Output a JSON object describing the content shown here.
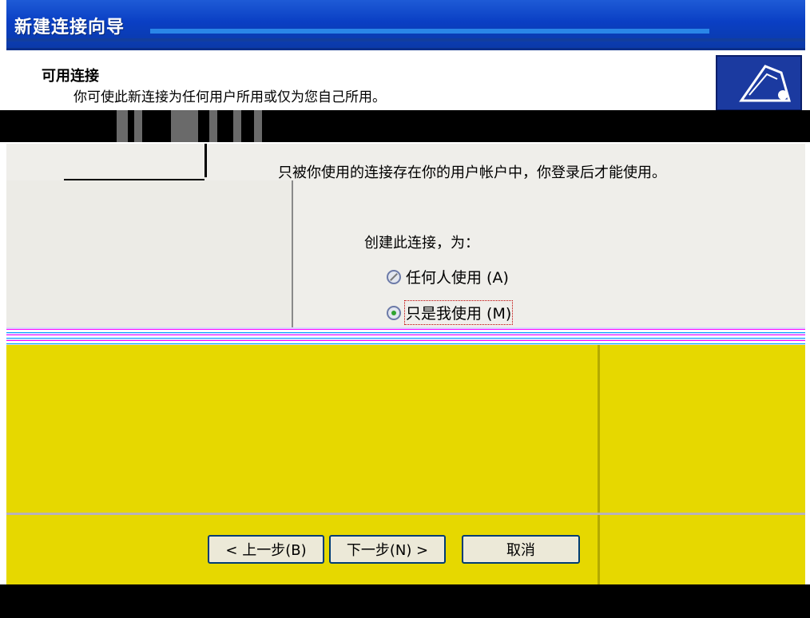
{
  "window": {
    "title": "新建连接向导"
  },
  "header": {
    "heading": "可用连接",
    "subheading": "你可使此新连接为任何用户所用或仅为您自己所用。"
  },
  "body": {
    "notice": "只被你使用的连接存在你的用户帐户中，你登录后才能使用。",
    "section_label": "创建此连接，为：",
    "options": [
      {
        "label": "任何人使用 (A)",
        "selected": false
      },
      {
        "label": "只是我使用 (M)",
        "selected": true
      }
    ]
  },
  "buttons": {
    "back": "< 上一步(B)",
    "next": "下一步(N) >",
    "cancel": "取消"
  },
  "colors": {
    "titlebar": "#0a3fc4",
    "footer": "#e6d800",
    "radio_selected": "#2fa42f"
  }
}
